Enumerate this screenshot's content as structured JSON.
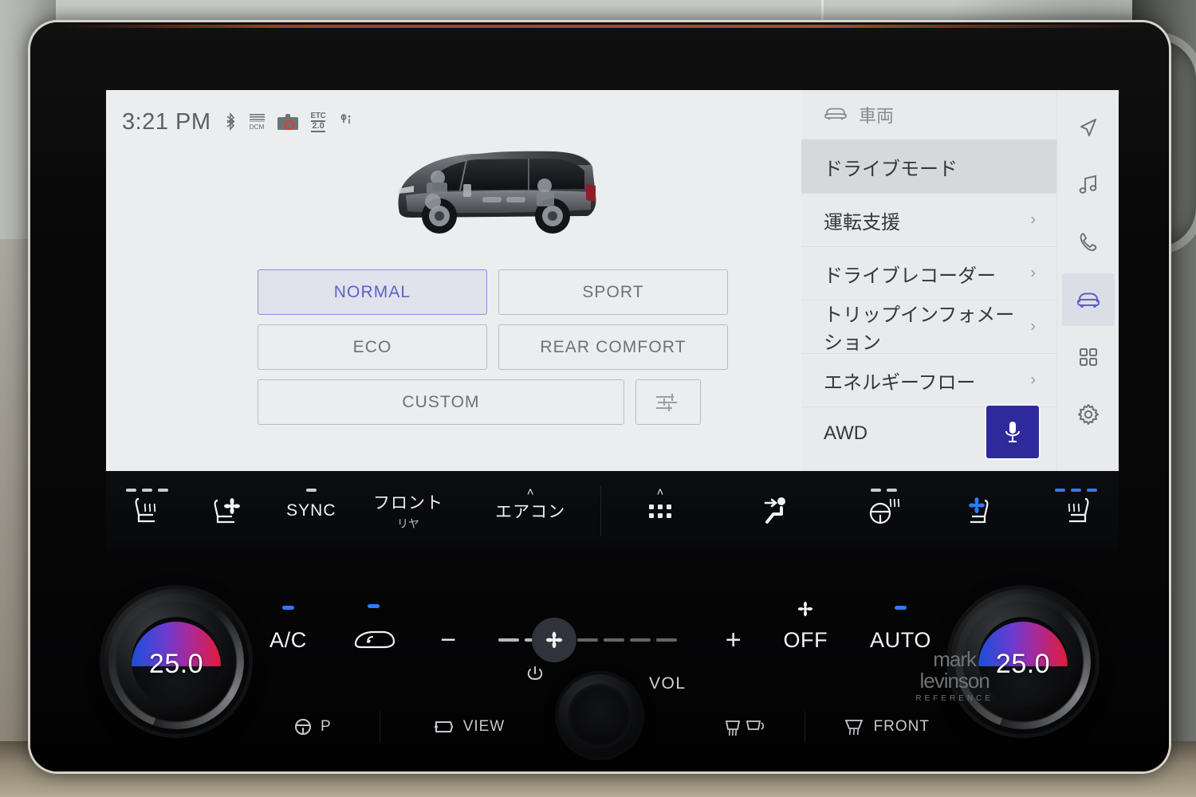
{
  "status_bar": {
    "time": "3:21 PM",
    "icons": [
      {
        "name": "bluetooth-icon",
        "glyph": "ᛦ"
      },
      {
        "name": "dcm-icon",
        "label": "DCM"
      },
      {
        "name": "dashcam-icon",
        "label": ""
      },
      {
        "name": "etc20-icon",
        "top": "ETC",
        "bottom": "2.0"
      },
      {
        "name": "qi-charging-icon",
        "glyph": "ф"
      }
    ]
  },
  "vehicle_image": {
    "alt": "minivan-cutaway-render",
    "body_color": "#3a3d42"
  },
  "drive_modes": {
    "selected": "NORMAL",
    "rows": [
      [
        {
          "label": "NORMAL",
          "selected": true
        },
        {
          "label": "SPORT",
          "selected": false
        }
      ],
      [
        {
          "label": "ECO",
          "selected": false
        },
        {
          "label": "REAR COMFORT",
          "selected": false
        }
      ]
    ],
    "custom": {
      "label": "CUSTOM",
      "selected": false
    },
    "settings_icon": "sliders-icon",
    "accent_color": "#5d60c8"
  },
  "menu": {
    "header": {
      "icon": "car-icon",
      "title": "車両"
    },
    "items": [
      {
        "label": "ドライブモード",
        "active": true,
        "chevron": ""
      },
      {
        "label": "運転支援",
        "active": false,
        "chevron": "›"
      },
      {
        "label": "ドライブレコーダー",
        "active": false,
        "chevron": "›"
      },
      {
        "label": "トリップインフォメーション",
        "active": false,
        "chevron": "›"
      },
      {
        "label": "エネルギーフロー",
        "active": false,
        "chevron": "›"
      },
      {
        "label": "AWD",
        "active": false,
        "chevron": ""
      }
    ],
    "mic_button": {
      "name": "voice-assistant-button",
      "color": "#2e2a9c"
    }
  },
  "rail": {
    "items": [
      {
        "name": "navigation-icon",
        "active": false
      },
      {
        "name": "media-icon",
        "active": false
      },
      {
        "name": "phone-icon",
        "active": false
      },
      {
        "name": "vehicle-icon",
        "active": true
      },
      {
        "name": "apps-icon",
        "active": false
      },
      {
        "name": "settings-icon",
        "active": false
      }
    ],
    "active_color": "#5d60c8"
  },
  "climate_strip": {
    "items": [
      {
        "name": "driver-seat-heater",
        "type": "icon",
        "icon": "heated-seat-icon",
        "levels": 3,
        "levels_active": 0
      },
      {
        "name": "driver-seat-ventilation",
        "type": "icon",
        "icon": "ventilated-seat-icon",
        "levels": 0
      },
      {
        "name": "sync-button",
        "type": "text",
        "label": "SYNC",
        "levels": 1,
        "levels_active": 1
      },
      {
        "name": "front-rear-toggle",
        "type": "text",
        "label": "フロント",
        "sub": "リヤ"
      },
      {
        "name": "aircon-button",
        "type": "text",
        "label": "エアコン",
        "chevron": "˄"
      },
      {
        "name": "more-menu-button",
        "type": "dots",
        "chevron": "˄"
      },
      {
        "name": "airflow-seat-icon",
        "type": "icon",
        "icon": "airflow-to-occupant-icon"
      },
      {
        "name": "steering-wheel-heater",
        "type": "icon",
        "icon": "heated-steering-wheel-icon",
        "levels": 2,
        "levels_active": 0
      },
      {
        "name": "passenger-seat-ventilation",
        "type": "icon",
        "icon": "ventilated-seat-icon-blue"
      },
      {
        "name": "passenger-seat-heater",
        "type": "icon",
        "icon": "heated-seat-icon",
        "levels": 3,
        "levels_active": 3
      }
    ]
  },
  "physical_controls": {
    "left_temperature": {
      "name": "driver-temperature-knob",
      "value": "25.0"
    },
    "right_temperature": {
      "name": "passenger-temperature-knob",
      "value": "25.0"
    },
    "buttons": [
      {
        "name": "ac-button",
        "label": "A/C",
        "indicator": true
      },
      {
        "name": "recirculation-button",
        "icon": "air-recirculation-icon",
        "indicator": true
      },
      {
        "name": "fan-decrease-button",
        "label": "−",
        "indicator": false
      },
      {
        "name": "fan-speed-slider",
        "segments": 7,
        "active_segment": 2
      },
      {
        "name": "fan-increase-button",
        "label": "+",
        "indicator": false
      },
      {
        "name": "fan-off-button",
        "label": "OFF",
        "icon": "fan-icon",
        "indicator": false
      },
      {
        "name": "auto-button",
        "label": "AUTO",
        "indicator": true
      }
    ],
    "bottom_row": [
      {
        "name": "park-button",
        "label": "P",
        "icon": "steering-wheel-icon"
      },
      {
        "name": "view-button",
        "label": "VIEW",
        "icon": "camera-icon"
      },
      {
        "name": "rear-defogger-button",
        "label": "",
        "icon": "rear-defog-icon"
      },
      {
        "name": "front-defroster-button",
        "label": "FRONT",
        "icon": "front-defrost-icon"
      }
    ],
    "volume_knob": {
      "name": "volume-knob",
      "label": "VOL",
      "power_icon": "power-icon"
    },
    "brand": {
      "line1": "mark",
      "line2": "levinson",
      "line3": "REFERENCE"
    }
  }
}
